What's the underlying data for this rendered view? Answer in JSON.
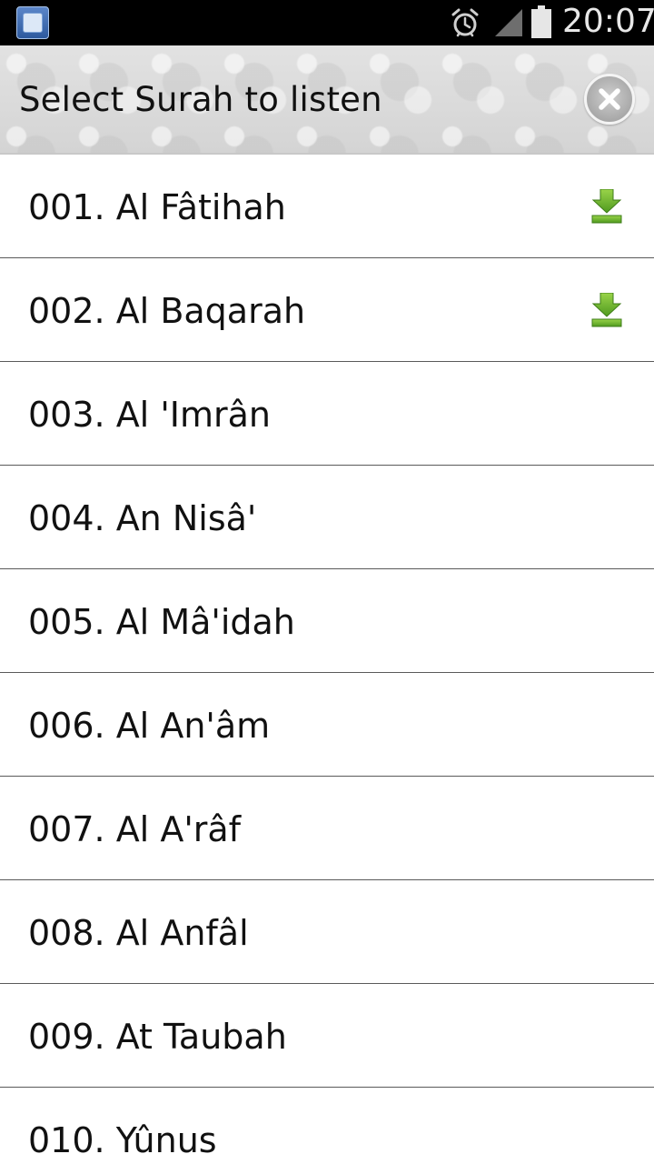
{
  "status_bar": {
    "time": "20:07",
    "icons": [
      "app-icon",
      "alarm-icon",
      "signal-icon",
      "battery-icon"
    ]
  },
  "header": {
    "title": "Select Surah to listen",
    "close_icon": "close-icon"
  },
  "colors": {
    "status_bar_bg": "#000000",
    "header_bg": "#dcdcdc",
    "download_green": "#6cb82e",
    "divider": "#5a5a5a"
  },
  "surahs": [
    {
      "label": "001. Al Fâtihah",
      "downloaded": true
    },
    {
      "label": "002. Al Baqarah",
      "downloaded": true
    },
    {
      "label": "003. Al 'Imrân",
      "downloaded": false
    },
    {
      "label": "004. An Nisâ'",
      "downloaded": false
    },
    {
      "label": "005. Al Mâ'idah",
      "downloaded": false
    },
    {
      "label": "006. Al An'âm",
      "downloaded": false
    },
    {
      "label": "007. Al A'râf",
      "downloaded": false
    },
    {
      "label": "008. Al Anfâl",
      "downloaded": false
    },
    {
      "label": "009. At Taubah",
      "downloaded": false
    },
    {
      "label": "010. Yûnus",
      "downloaded": false
    }
  ]
}
